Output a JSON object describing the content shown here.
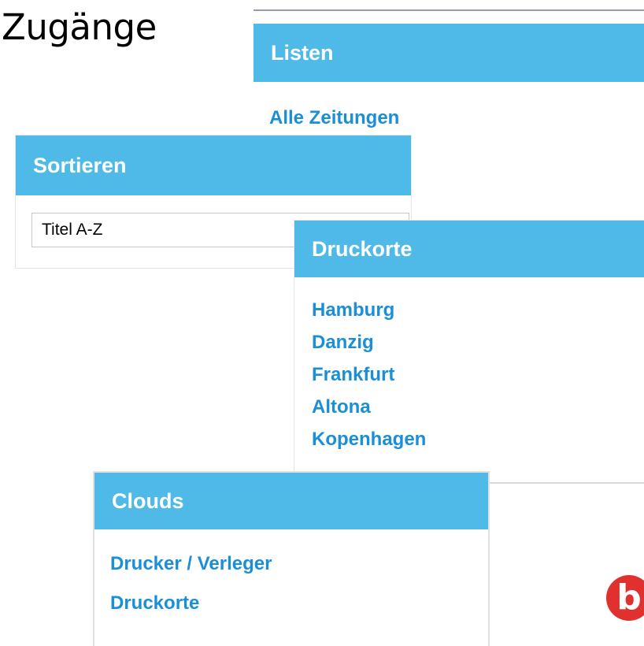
{
  "page_title": "Zugänge",
  "listen": {
    "header": "Listen",
    "links": [
      "Alle Zeitungen"
    ]
  },
  "sortieren": {
    "header": "Sortieren",
    "selected": "Titel A-Z"
  },
  "druckorte": {
    "header": "Druckorte",
    "links": [
      "Hamburg",
      "Danzig",
      "Frankfurt",
      "Altona",
      "Kopenhagen"
    ]
  },
  "clouds": {
    "header": "Clouds",
    "links": [
      "Drucker / Verleger",
      "Druckorte"
    ]
  },
  "logo": {
    "letter": "b",
    "color": "#e0312f"
  },
  "accent_color": "#4fb9e8",
  "link_color": "#1a8fd6"
}
